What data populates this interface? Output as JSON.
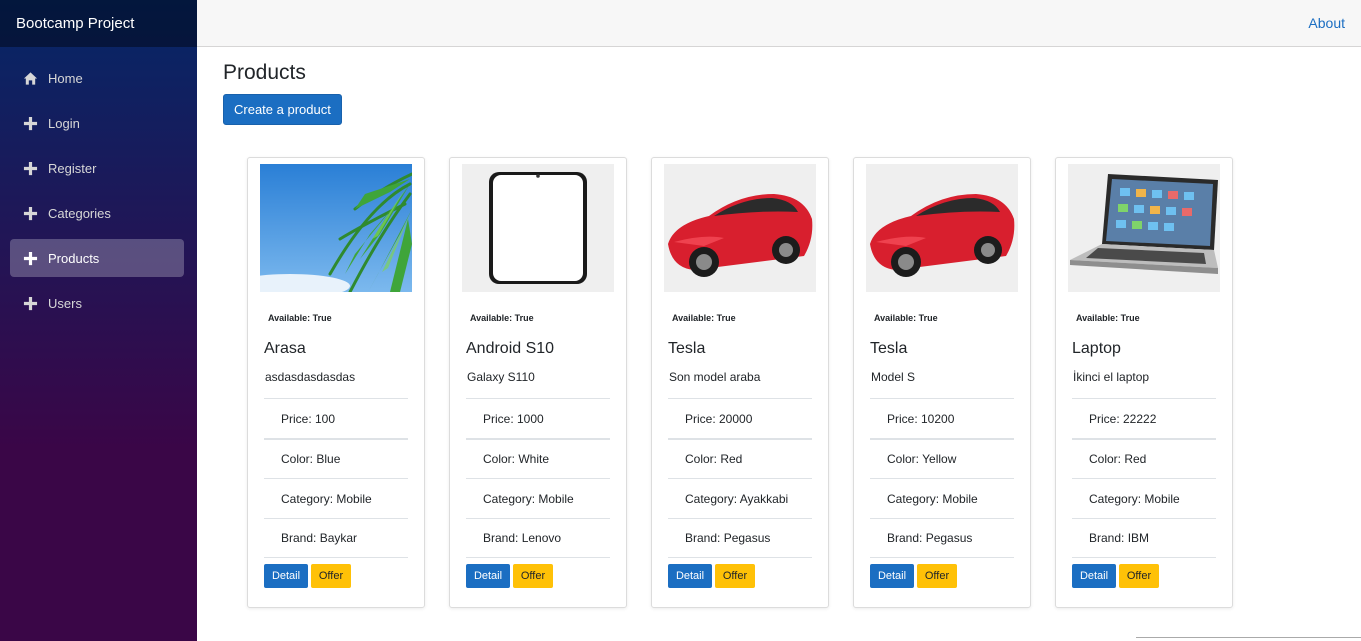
{
  "app": {
    "brand": "Bootcamp Project"
  },
  "sidebar": {
    "items": [
      {
        "label": "Home",
        "icon": "home-icon",
        "active": false
      },
      {
        "label": "Login",
        "icon": "plus-icon",
        "active": false
      },
      {
        "label": "Register",
        "icon": "plus-icon",
        "active": false
      },
      {
        "label": "Categories",
        "icon": "plus-icon",
        "active": false
      },
      {
        "label": "Products",
        "icon": "plus-icon",
        "active": true
      },
      {
        "label": "Users",
        "icon": "plus-icon",
        "active": false
      }
    ]
  },
  "topbar": {
    "about_label": "About"
  },
  "page": {
    "title": "Products",
    "create_label": "Create a product"
  },
  "products": [
    {
      "available": "Available: True",
      "name": "Arasa",
      "description": "asdasdasdasdas",
      "price": "Price: 100",
      "color": "Color: Blue",
      "category": "Category: Mobile",
      "brand": "Brand: Baykar",
      "detail_label": "Detail",
      "offer_label": "Offer",
      "image": "palm-tree-image"
    },
    {
      "available": "Available: True",
      "name": "Android S10",
      "description": "Galaxy S110",
      "price": "Price: 1000",
      "color": "Color: White",
      "category": "Category: Mobile",
      "brand": "Brand: Lenovo",
      "detail_label": "Detail",
      "offer_label": "Offer",
      "image": "phone-image"
    },
    {
      "available": "Available: True",
      "name": "Tesla",
      "description": "Son model araba",
      "price": "Price: 20000",
      "color": "Color: Red",
      "category": "Category: Ayakkabi",
      "brand": "Brand: Pegasus",
      "detail_label": "Detail",
      "offer_label": "Offer",
      "image": "red-car-image"
    },
    {
      "available": "Available: True",
      "name": "Tesla",
      "description": "Model S",
      "price": "Price: 10200",
      "color": "Color: Yellow",
      "category": "Category: Mobile",
      "brand": "Brand: Pegasus",
      "detail_label": "Detail",
      "offer_label": "Offer",
      "image": "red-car-image"
    },
    {
      "available": "Available: True",
      "name": "Laptop",
      "description": "İkinci el laptop",
      "price": "Price: 22222",
      "color": "Color: Red",
      "category": "Category: Mobile",
      "brand": "Brand: IBM",
      "detail_label": "Detail",
      "offer_label": "Offer",
      "image": "laptop-image"
    }
  ],
  "colors": {
    "primary": "#1b6ec2",
    "warning": "#ffc107",
    "sidebar_top": "#052767",
    "sidebar_bottom": "#3a0647"
  }
}
